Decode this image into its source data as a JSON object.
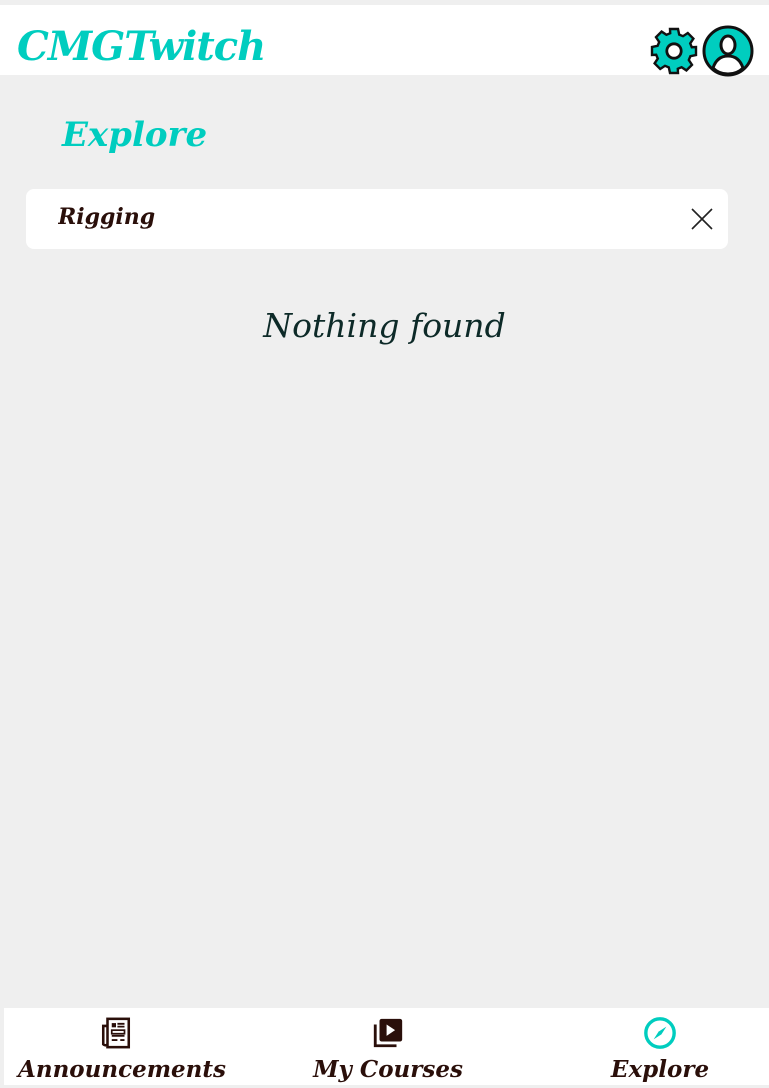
{
  "header": {
    "app_title": "CMGTwitch",
    "settings_icon": "gear-icon",
    "profile_icon": "user-icon"
  },
  "page": {
    "title": "Explore"
  },
  "search": {
    "value": "Rigging",
    "placeholder": ""
  },
  "results": {
    "empty_text": "Nothing found"
  },
  "nav": {
    "items": [
      {
        "label": "Announcements",
        "icon": "newspaper-icon"
      },
      {
        "label": "My Courses",
        "icon": "video-library-icon"
      },
      {
        "label": "Explore",
        "icon": "compass-icon",
        "active": true
      }
    ]
  },
  "colors": {
    "accent": "#00cdbf",
    "text": "#2a0f0a"
  }
}
